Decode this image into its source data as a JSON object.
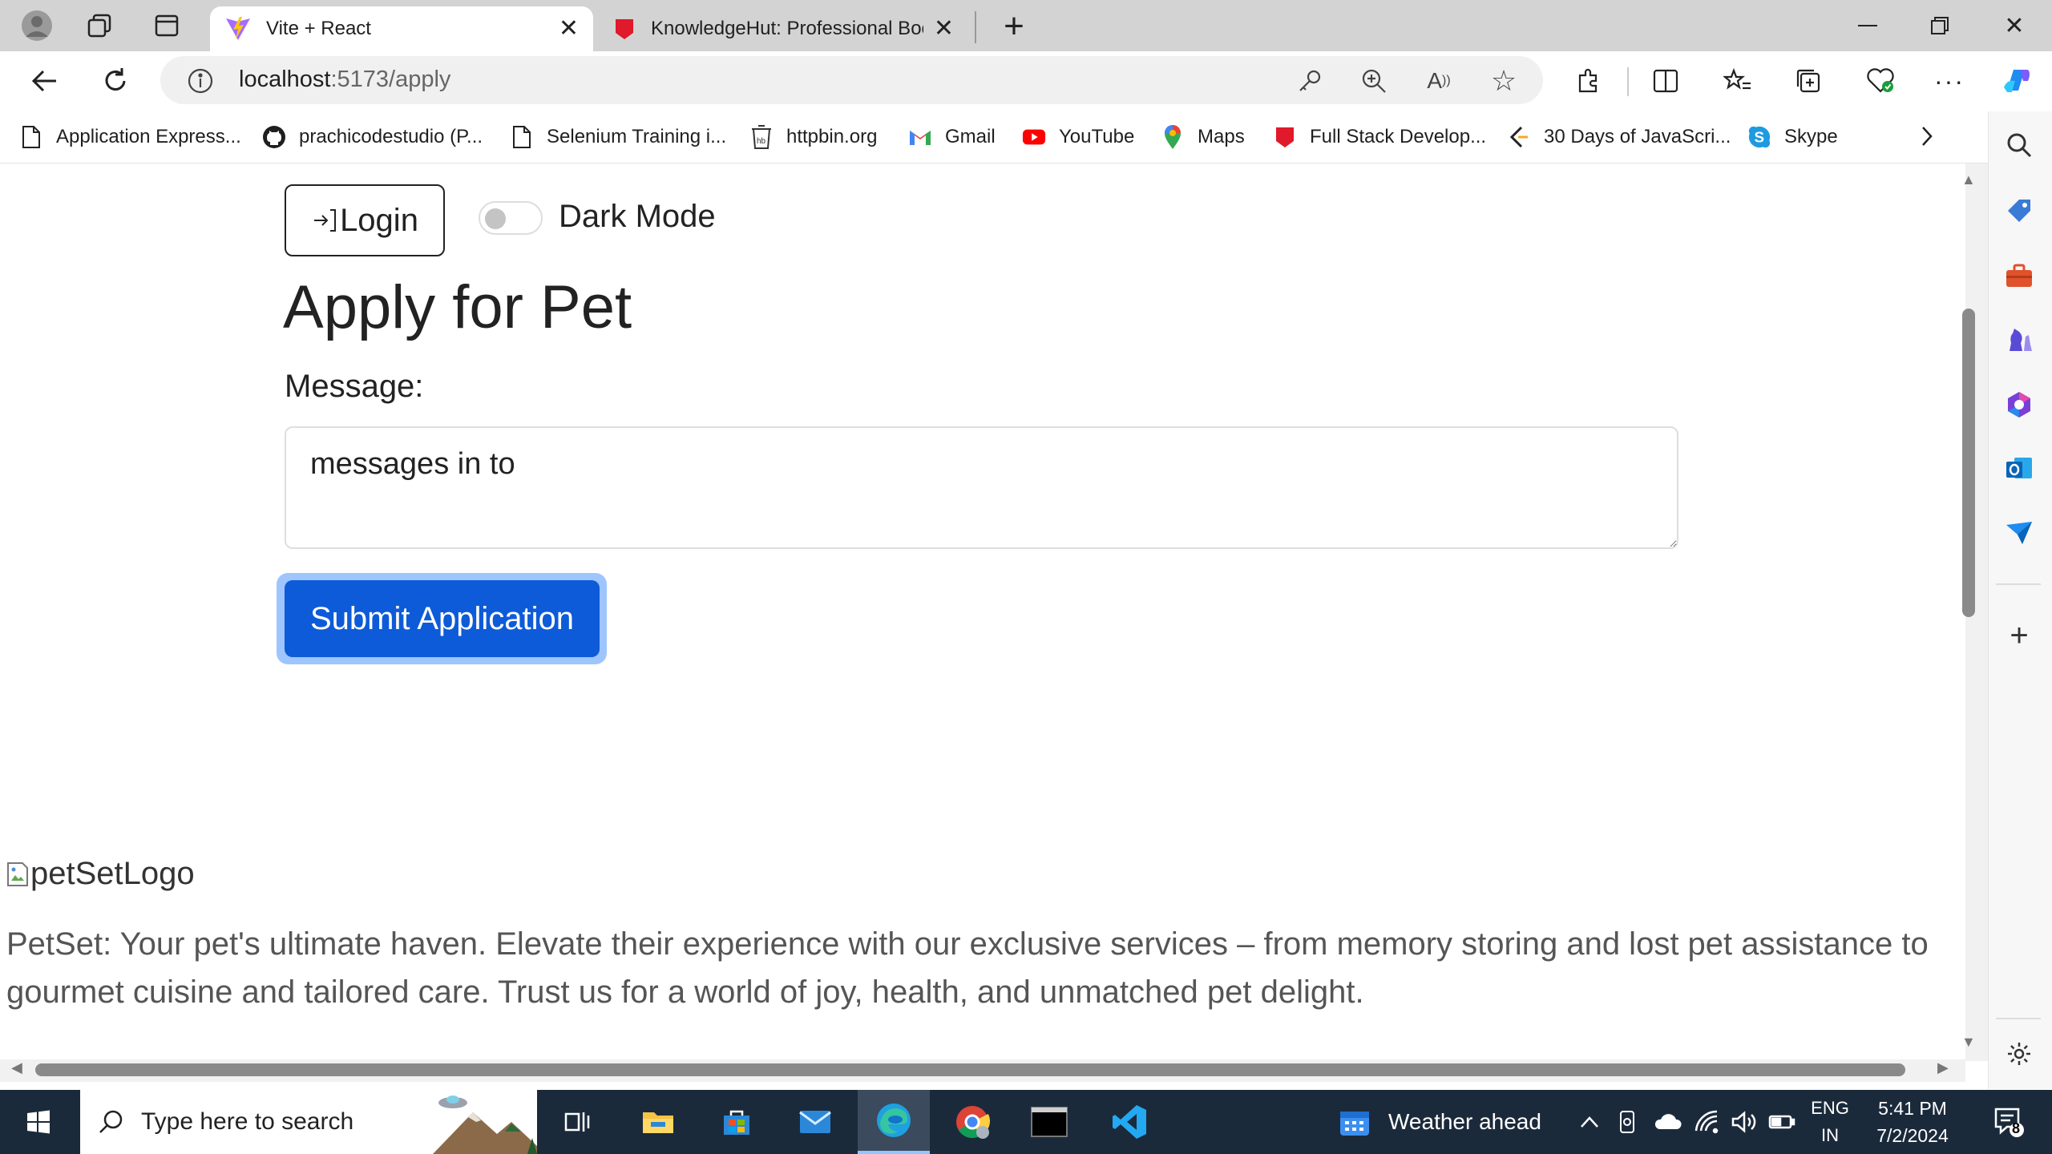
{
  "browser": {
    "tabs": [
      {
        "title": "Vite + React",
        "active": true
      },
      {
        "title": "KnowledgeHut: Professional Boo",
        "active": false
      }
    ],
    "address": {
      "host": "localhost",
      "path": ":5173/apply"
    },
    "bookmarks": [
      {
        "label": "Application Express...",
        "icon": "page-icon"
      },
      {
        "label": "prachicodestudio (P...",
        "icon": "github-icon"
      },
      {
        "label": "Selenium Training i...",
        "icon": "page-icon"
      },
      {
        "label": "httpbin.org",
        "icon": "httpbin-icon"
      },
      {
        "label": "Gmail",
        "icon": "gmail-icon"
      },
      {
        "label": "YouTube",
        "icon": "youtube-icon"
      },
      {
        "label": "Maps",
        "icon": "maps-icon"
      },
      {
        "label": "Full Stack Develop...",
        "icon": "knowledgehut-icon"
      },
      {
        "label": "30 Days of JavaScri...",
        "icon": "js-icon"
      },
      {
        "label": "Skype",
        "icon": "skype-icon"
      }
    ]
  },
  "page": {
    "login_label": "Login",
    "dark_mode_label": "Dark Mode",
    "dark_mode_on": false,
    "title": "Apply for Pet",
    "message_label": "Message:",
    "message_value": "messages in to",
    "submit_label": "Submit Application",
    "logo_alt": "petSetLogo",
    "footer_text": "PetSet: Your pet's ultimate haven. Elevate their experience with our exclusive services – from memory storing and lost pet assistance to gourmet cuisine and tailored care. Trust us for a world of joy, health, and unmatched pet delight."
  },
  "taskbar": {
    "search_placeholder": "Type here to search",
    "weather": "Weather ahead",
    "lang_top": "ENG",
    "lang_bottom": "IN",
    "time": "5:41 PM",
    "date": "7/2/2024",
    "notification_count": "8"
  },
  "colors": {
    "primary_button": "#0d5bd8",
    "tabstrip": "#d3d3d3",
    "taskbar": "#1b2a3b"
  }
}
